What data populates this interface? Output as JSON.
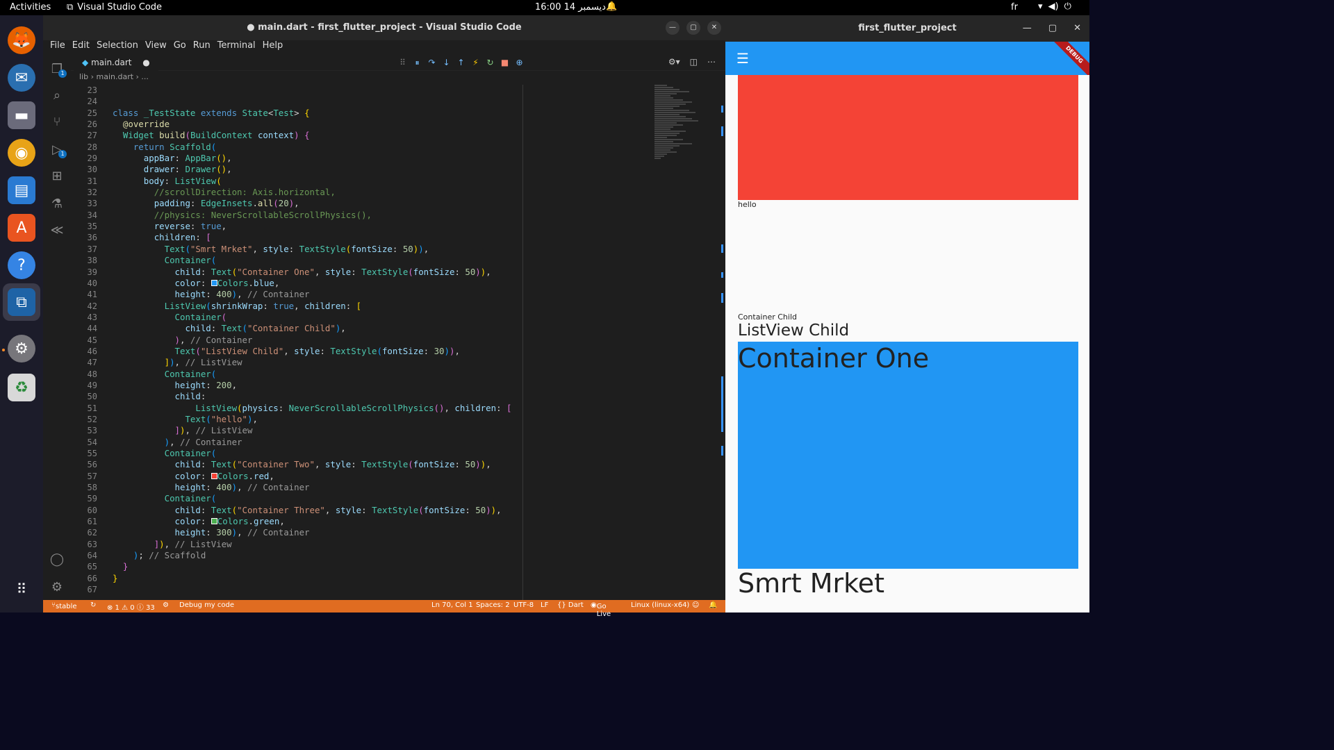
{
  "topbar": {
    "activities": "Activities",
    "app_name": "Visual Studio Code",
    "clock": "16:00  14 ديسمبر",
    "language": "fr"
  },
  "vscode": {
    "title": "● main.dart - first_flutter_project - Visual Studio Code",
    "menu": [
      "File",
      "Edit",
      "Selection",
      "View",
      "Go",
      "Run",
      "Terminal",
      "Help"
    ],
    "tab_label": "main.dart",
    "breadcrumb": "lib  ›  main.dart › ...",
    "line_start": 23,
    "line_count": 45,
    "status": {
      "branch": "stable",
      "problems": "⊗ 1 ⚠ 0 ⓘ 33",
      "debug": "Debug my code",
      "position": "Ln 70, Col 1",
      "spaces": "Spaces: 2",
      "encoding": "UTF-8",
      "eol": "LF",
      "language": "{} Dart",
      "golive": "Go Live",
      "platform": "Linux (linux-x64)"
    }
  },
  "flutter": {
    "title": "first_flutter_project",
    "debug_banner": "DEBUG",
    "hello": "hello",
    "container_child": "Container Child",
    "listview_child": "ListView Child",
    "container_one": "Container One",
    "smrt_mrket": "Smrt Mrket",
    "colors": {
      "appbar": "#2196f3",
      "red": "#f44336",
      "blue": "#2196f3"
    }
  }
}
